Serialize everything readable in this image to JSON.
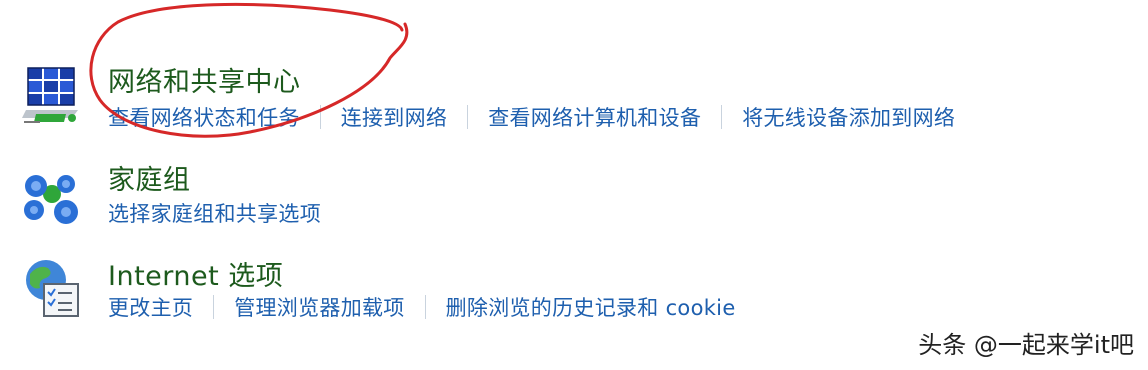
{
  "network": {
    "title": "网络和共享中心",
    "icon": "network-icon",
    "links": [
      "查看网络状态和任务",
      "连接到网络",
      "查看网络计算机和设备",
      "将无线设备添加到网络"
    ]
  },
  "homegroup": {
    "title": "家庭组",
    "icon": "homegroup-icon",
    "links": [
      "选择家庭组和共享选项"
    ]
  },
  "internet": {
    "title": "Internet 选项",
    "icon": "internet-options-icon",
    "links": [
      "更改主页",
      "管理浏览器加载项",
      "删除浏览的历史记录和 cookie"
    ]
  },
  "colors": {
    "title": "#1d5a1d",
    "link": "#1e5fae",
    "annotation": "#d62828"
  },
  "watermark": "头条 @一起来学it吧"
}
